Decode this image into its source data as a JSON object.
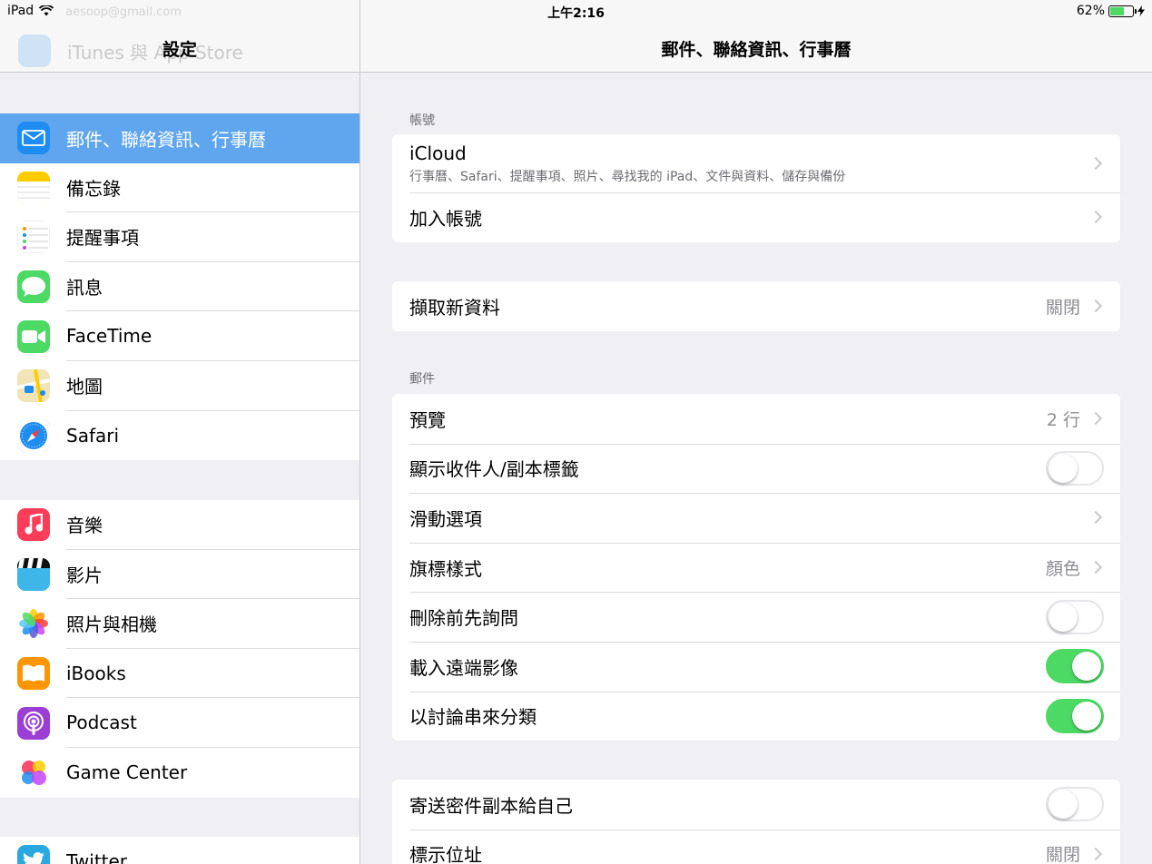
{
  "status": {
    "device": "iPad",
    "time": "上午2:16",
    "battery": "62%",
    "battery_level": 0.62
  },
  "sidebar": {
    "title": "設定",
    "ghost_email": "aesoop@gmail.com",
    "ghost_item": "iTunes 與 App Store",
    "groups": [
      {
        "items": [
          {
            "label": "郵件、聯絡資訊、行事曆",
            "icon": "mail-icon",
            "color": "#1e8cf0",
            "selected": true
          },
          {
            "label": "備忘錄",
            "icon": "notes-icon",
            "color": "#ffcc00"
          },
          {
            "label": "提醒事項",
            "icon": "reminders-icon",
            "color": "#ffffff"
          },
          {
            "label": "訊息",
            "icon": "messages-icon",
            "color": "#4cd964"
          },
          {
            "label": "FaceTime",
            "icon": "facetime-icon",
            "color": "#4cd964"
          },
          {
            "label": "地圖",
            "icon": "maps-icon",
            "color": "#f1e4b6"
          },
          {
            "label": "Safari",
            "icon": "safari-icon",
            "color": "#1e8cf0"
          }
        ]
      },
      {
        "items": [
          {
            "label": "音樂",
            "icon": "music-icon",
            "color": "#fc3d59"
          },
          {
            "label": "影片",
            "icon": "videos-icon",
            "color": "#3fb6e8"
          },
          {
            "label": "照片與相機",
            "icon": "photos-icon",
            "color": "#ffffff"
          },
          {
            "label": "iBooks",
            "icon": "ibooks-icon",
            "color": "#ff9500"
          },
          {
            "label": "Podcast",
            "icon": "podcast-icon",
            "color": "#9b3fd4"
          },
          {
            "label": "Game Center",
            "icon": "game-center-icon",
            "color": "#ffffff"
          }
        ]
      },
      {
        "items": [
          {
            "label": "Twitter",
            "icon": "twitter-icon",
            "color": "#2aa9e0"
          }
        ]
      }
    ]
  },
  "detail": {
    "title": "郵件、聯絡資訊、行事曆",
    "accounts_label": "帳號",
    "icloud_title": "iCloud",
    "icloud_sub": "行事曆、Safari、提醒事項、照片、尋找我的 iPad、文件與資料、儲存與備份",
    "add_account": "加入帳號",
    "fetch_label": "擷取新資料",
    "fetch_value": "關閉",
    "mail_label": "郵件",
    "mail_rows": [
      {
        "label": "預覽",
        "value": "2 行",
        "type": "chevron"
      },
      {
        "label": "顯示收件人/副本標籤",
        "type": "switch",
        "on": false
      },
      {
        "label": "滑動選項",
        "value": "",
        "type": "chevron"
      },
      {
        "label": "旗標樣式",
        "value": "顏色",
        "type": "chevron"
      },
      {
        "label": "刪除前先詢問",
        "type": "switch",
        "on": false
      },
      {
        "label": "載入遠端影像",
        "type": "switch",
        "on": true
      },
      {
        "label": "以討論串來分類",
        "type": "switch",
        "on": true
      }
    ],
    "bcc_label": "寄送密件副本給自己",
    "bcc_on": false,
    "mark_label": "標示位址",
    "mark_value": "關閉"
  }
}
